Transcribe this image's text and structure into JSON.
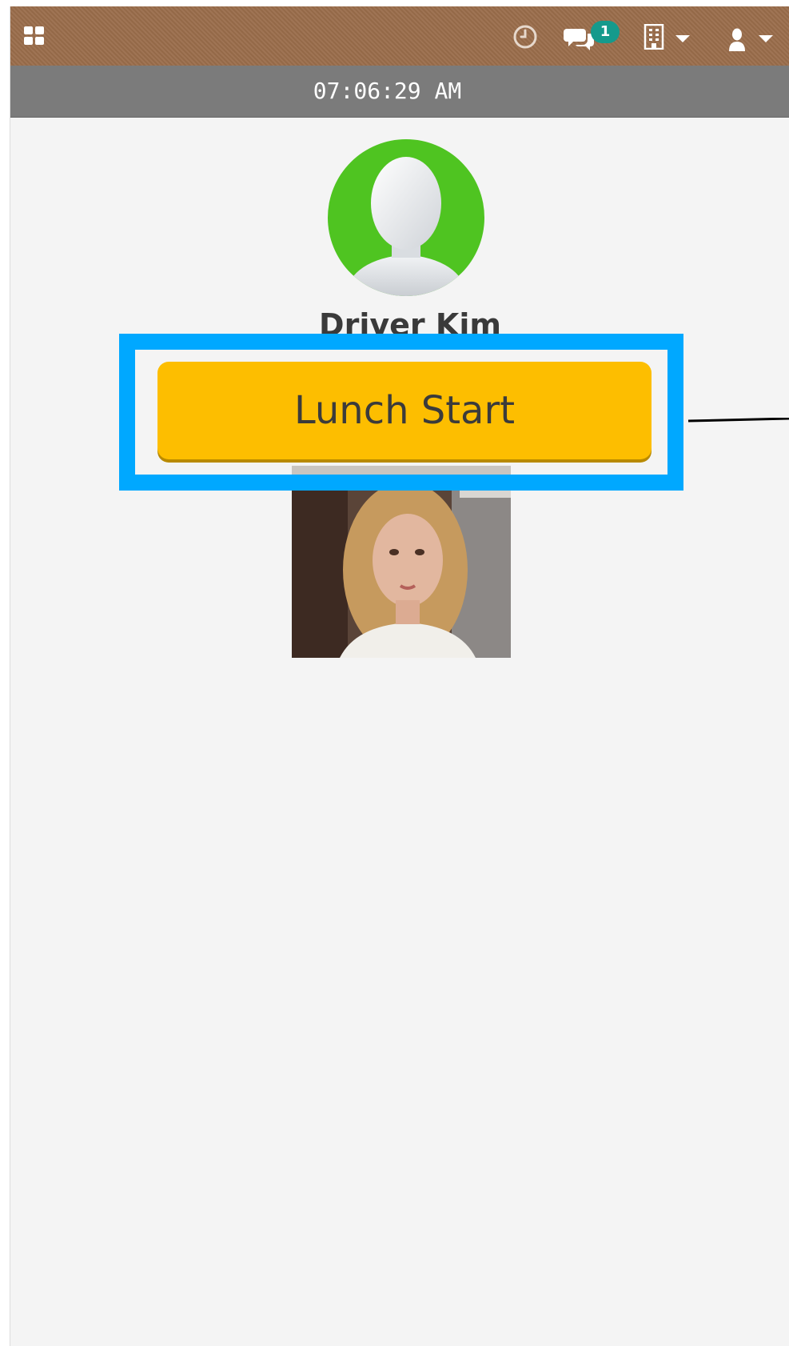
{
  "topbar": {
    "background_color": "#9a6d4b",
    "icons": [
      "grid-icon",
      "clock-icon",
      "chat-icon",
      "building-icon",
      "user-icon"
    ],
    "notification_count": "1",
    "badge_color": "#159a8c"
  },
  "timebar": {
    "time": "07:06:29 AM",
    "background_color": "#7b7b7b"
  },
  "profile": {
    "name": "Driver Kim",
    "avatar_ring_color": "#4fc421"
  },
  "actions": {
    "lunch_start_label": "Lunch Start",
    "button_color": "#fdbe00",
    "highlight_color": "#00a8ff"
  }
}
